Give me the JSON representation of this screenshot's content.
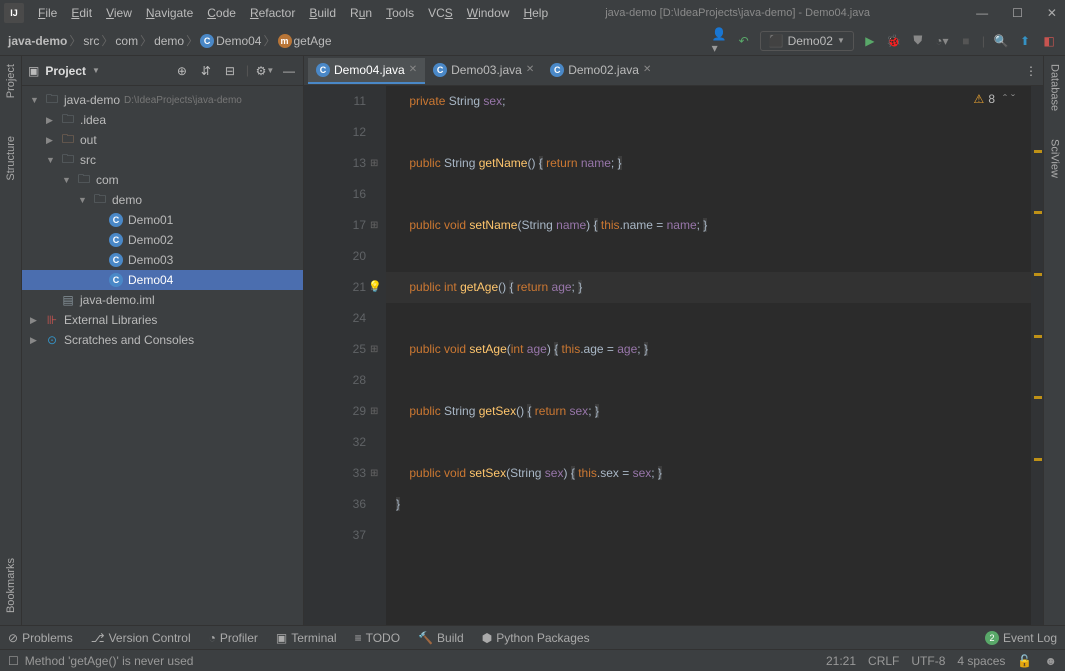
{
  "titlebar": {
    "title": "java-demo [D:\\IdeaProjects\\java-demo] - Demo04.java",
    "menus": [
      "File",
      "Edit",
      "View",
      "Navigate",
      "Code",
      "Refactor",
      "Build",
      "Run",
      "Tools",
      "VCS",
      "Window",
      "Help"
    ]
  },
  "breadcrumb": {
    "items": [
      "java-demo",
      "src",
      "com",
      "demo",
      "Demo04",
      "getAge"
    ]
  },
  "runConfig": "Demo02",
  "projectPanel": {
    "title": "Project",
    "root": {
      "name": "java-demo",
      "path": "D:\\IdeaProjects\\java-demo"
    },
    "tree": [
      {
        "indent": 0,
        "arrow": "▼",
        "icon": "folder",
        "label": "java-demo",
        "dim": "D:\\IdeaProjects\\java-demo"
      },
      {
        "indent": 1,
        "arrow": "▶",
        "icon": "folder",
        "label": ".idea"
      },
      {
        "indent": 1,
        "arrow": "▶",
        "icon": "folder-orange",
        "label": "out"
      },
      {
        "indent": 1,
        "arrow": "▼",
        "icon": "folder",
        "label": "src"
      },
      {
        "indent": 2,
        "arrow": "▼",
        "icon": "folder",
        "label": "com"
      },
      {
        "indent": 3,
        "arrow": "▼",
        "icon": "folder",
        "label": "demo"
      },
      {
        "indent": 4,
        "arrow": "",
        "icon": "class",
        "label": "Demo01"
      },
      {
        "indent": 4,
        "arrow": "",
        "icon": "class",
        "label": "Demo02"
      },
      {
        "indent": 4,
        "arrow": "",
        "icon": "class",
        "label": "Demo03"
      },
      {
        "indent": 4,
        "arrow": "",
        "icon": "class",
        "label": "Demo04",
        "selected": true
      },
      {
        "indent": 1,
        "arrow": "",
        "icon": "file",
        "label": "java-demo.iml"
      },
      {
        "indent": 0,
        "arrow": "▶",
        "icon": "lib",
        "label": "External Libraries"
      },
      {
        "indent": 0,
        "arrow": "▶",
        "icon": "scratch",
        "label": "Scratches and Consoles"
      }
    ]
  },
  "tabs": [
    {
      "label": "Demo04.java",
      "active": true
    },
    {
      "label": "Demo03.java",
      "active": false
    },
    {
      "label": "Demo02.java",
      "active": false
    }
  ],
  "problemsCount": "8",
  "code": {
    "lines": [
      {
        "n": 11,
        "t": "    private String sex;"
      },
      {
        "n": 12,
        "t": ""
      },
      {
        "n": 13,
        "t": "    public String getName() { return name; }",
        "fold": true
      },
      {
        "n": 16,
        "t": ""
      },
      {
        "n": 17,
        "t": "    public void setName(String name) { this.name = name; }",
        "fold": true
      },
      {
        "n": 20,
        "t": ""
      },
      {
        "n": 21,
        "t": "    public int getAge() { return age; }",
        "fold": true,
        "hl": true,
        "bulb": true
      },
      {
        "n": 24,
        "t": ""
      },
      {
        "n": 25,
        "t": "    public void setAge(int age) { this.age = age; }",
        "fold": true
      },
      {
        "n": 28,
        "t": ""
      },
      {
        "n": 29,
        "t": "    public String getSex() { return sex; }",
        "fold": true
      },
      {
        "n": 32,
        "t": ""
      },
      {
        "n": 33,
        "t": "    public void setSex(String sex) { this.sex = sex; }",
        "fold": true
      },
      {
        "n": 36,
        "t": "}"
      },
      {
        "n": 37,
        "t": ""
      }
    ]
  },
  "bottomTabs": {
    "problems": "Problems",
    "vcs": "Version Control",
    "profiler": "Profiler",
    "terminal": "Terminal",
    "todo": "TODO",
    "build": "Build",
    "python": "Python Packages",
    "eventLog": "Event Log",
    "eventCount": "2"
  },
  "statusBar": {
    "message": "Method 'getAge()' is never used",
    "pos": "21:21",
    "sep": "CRLF",
    "enc": "UTF-8",
    "indent": "4 spaces"
  },
  "leftGutter": {
    "project": "Project",
    "structure": "Structure",
    "bookmarks": "Bookmarks"
  },
  "rightGutter": {
    "database": "Database",
    "sciview": "SciView"
  }
}
